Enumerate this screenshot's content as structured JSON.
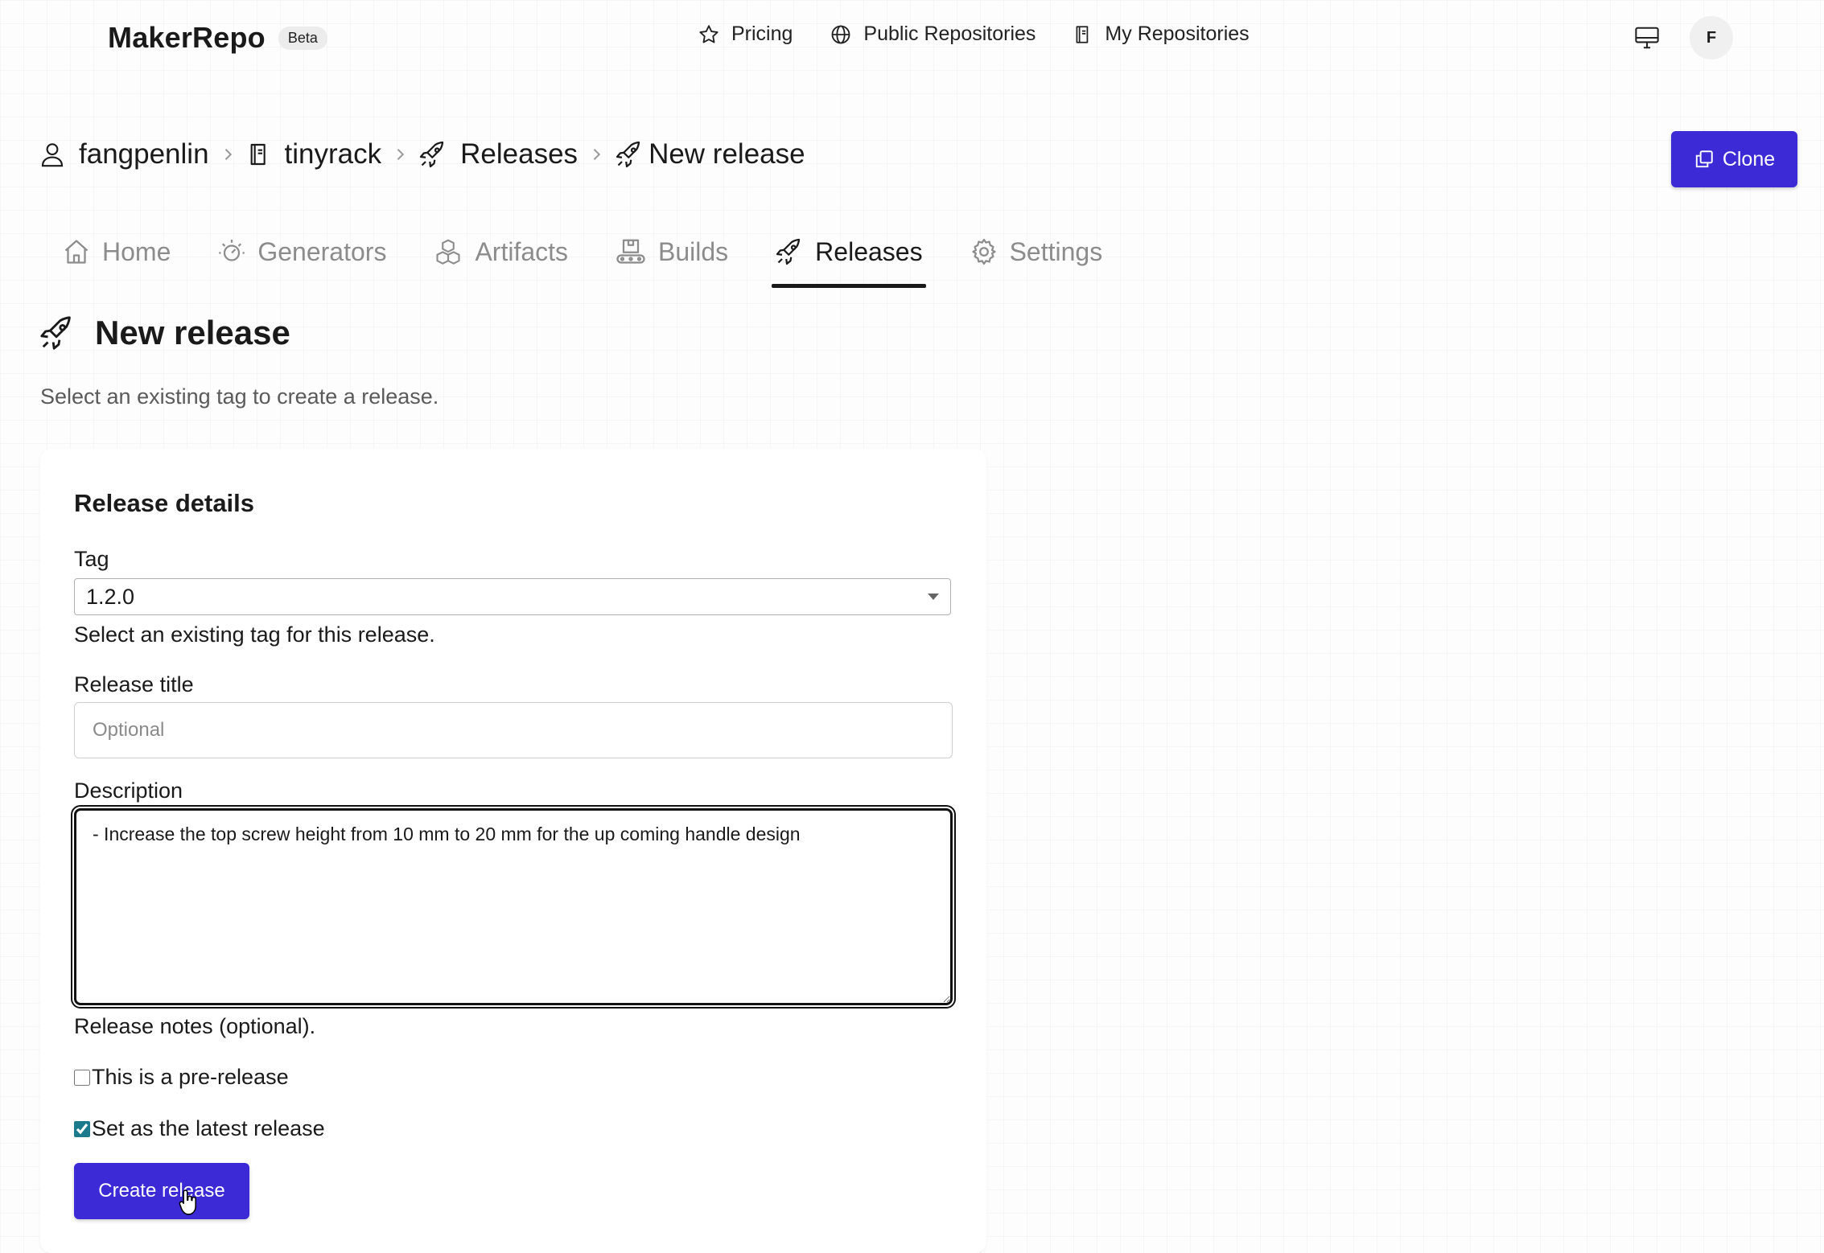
{
  "brand": {
    "name": "MakerRepo",
    "badge": "Beta"
  },
  "topnav": {
    "items": [
      {
        "label": "Pricing",
        "icon": "star-icon"
      },
      {
        "label": "Public Repositories",
        "icon": "globe-icon"
      },
      {
        "label": "My Repositories",
        "icon": "book-icon"
      }
    ],
    "avatar_initial": "F"
  },
  "breadcrumb": {
    "user": "fangpenlin",
    "repo": "tinyrack",
    "section": "Releases",
    "current": "New release"
  },
  "actions": {
    "clone_label": "Clone"
  },
  "tabs": [
    {
      "label": "Home",
      "icon": "home-icon",
      "active": false
    },
    {
      "label": "Generators",
      "icon": "generator-icon",
      "active": false
    },
    {
      "label": "Artifacts",
      "icon": "boxes-icon",
      "active": false
    },
    {
      "label": "Builds",
      "icon": "conveyor-icon",
      "active": false
    },
    {
      "label": "Releases",
      "icon": "rocket-icon",
      "active": true
    },
    {
      "label": "Settings",
      "icon": "gear-icon",
      "active": false
    }
  ],
  "page": {
    "title": "New release",
    "subtitle": "Select an existing tag to create a release."
  },
  "form": {
    "card_title": "Release details",
    "tag": {
      "label": "Tag",
      "value": "1.2.0",
      "help": "Select an existing tag for this release."
    },
    "release_title": {
      "label": "Release title",
      "placeholder": "Optional",
      "value": ""
    },
    "description": {
      "label": "Description",
      "value": "- Increase the top screw height from 10 mm to 20 mm for the up coming handle design",
      "help": "Release notes (optional)."
    },
    "prerelease": {
      "label": "This is a pre-release",
      "checked": false
    },
    "latest": {
      "label": "Set as the latest release",
      "checked": true
    },
    "submit_label": "Create release"
  },
  "colors": {
    "primary": "#3b2ad6",
    "checkbox_accent": "#1c7a8c"
  }
}
